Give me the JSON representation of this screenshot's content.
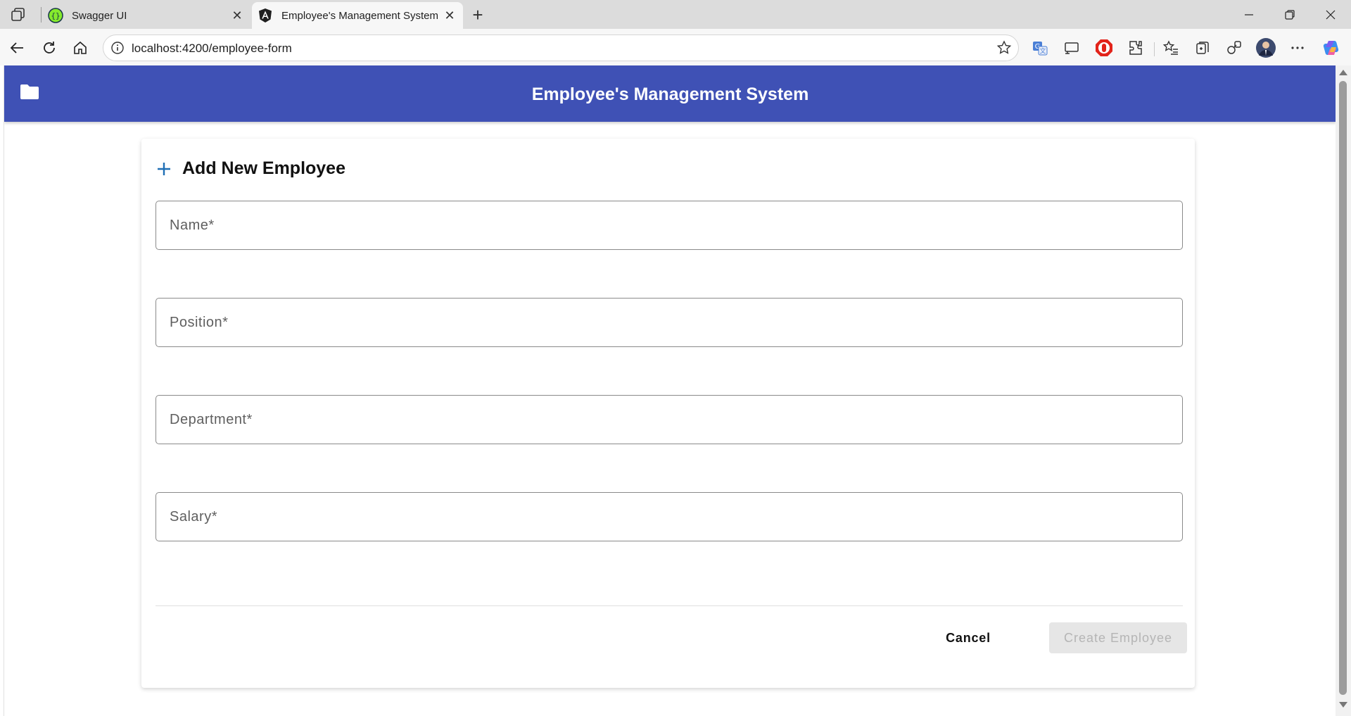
{
  "browser": {
    "tabs": [
      {
        "title": "Swagger UI",
        "icon": "swagger-icon",
        "active": false
      },
      {
        "title": "Employee's Management System",
        "icon": "angular-icon",
        "active": true
      }
    ],
    "address_bar": {
      "url": "localhost:4200/employee-form"
    }
  },
  "app": {
    "header_title": "Employee's Management System",
    "header_icon": "folder-icon",
    "header_color": "#3f51b5"
  },
  "form": {
    "title": "Add New Employee",
    "title_icon": "plus-icon",
    "fields": {
      "name": {
        "placeholder": "Name*",
        "value": ""
      },
      "position": {
        "placeholder": "Position*",
        "value": ""
      },
      "department": {
        "placeholder": "Department*",
        "value": ""
      },
      "salary": {
        "placeholder": "Salary*",
        "value": ""
      }
    },
    "cancel_label": "Cancel",
    "submit_label": "Create Employee",
    "submit_disabled": true
  }
}
